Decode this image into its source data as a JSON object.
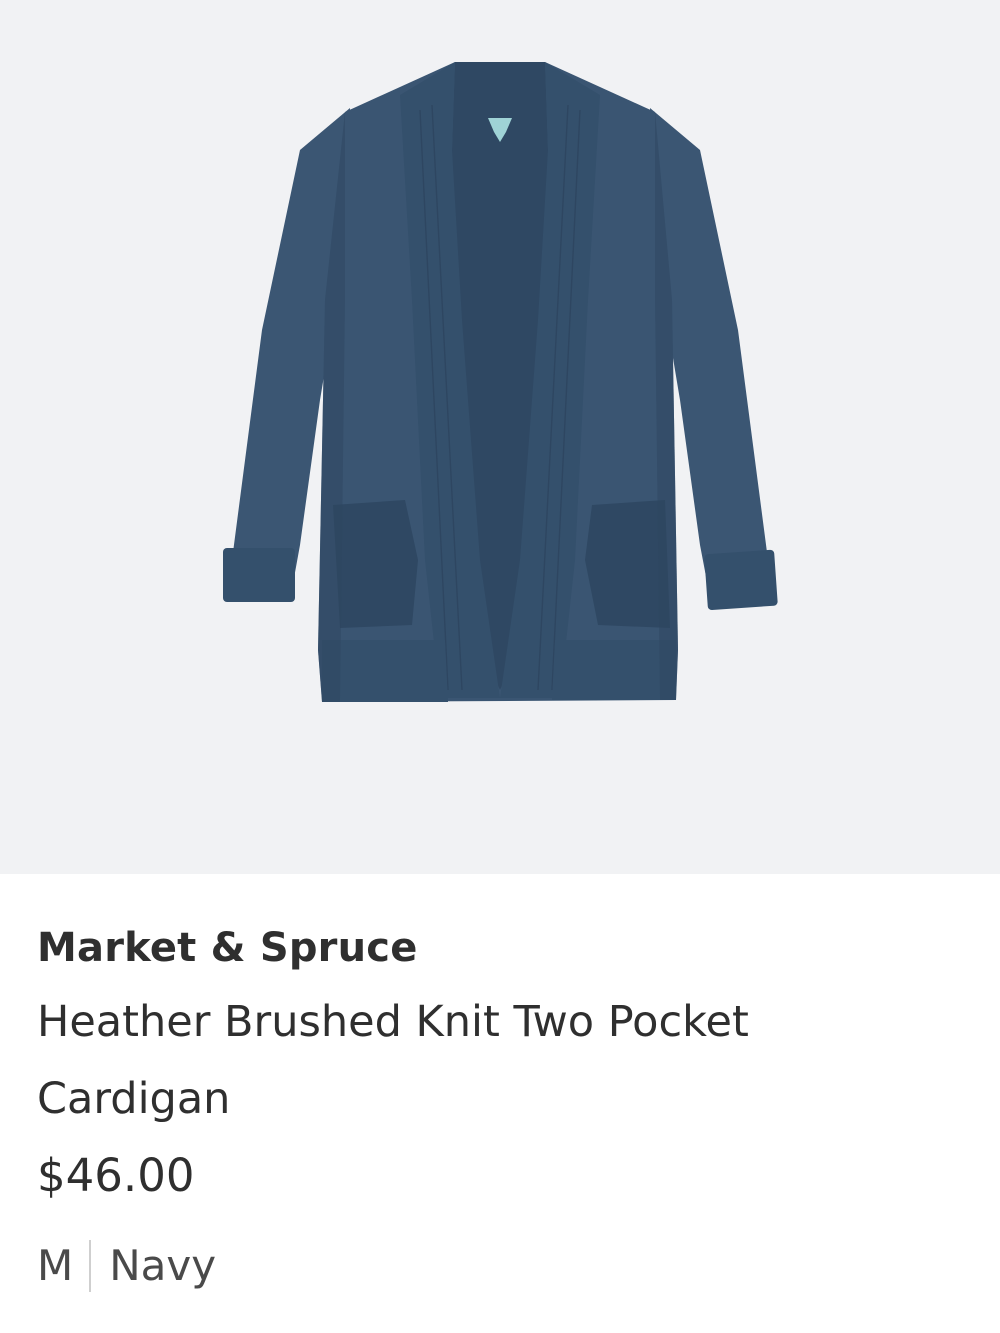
{
  "product": {
    "image_alt": "Navy heather brushed knit open-front cardigan with two pockets",
    "brand": "Market & Spruce",
    "name": "Heather Brushed Knit Two Pocket Cardigan",
    "price": "$46.00",
    "size": "M",
    "color": "Navy"
  },
  "colors": {
    "image_background": "#f1f2f4",
    "garment": "#3b5673",
    "garment_dark": "#2e4560",
    "garment_shadow": "#24384f",
    "tag": "#9fd3d6",
    "text": "#2f2f2f",
    "divider": "#cfcfcf"
  },
  "icons": {
    "product_image": "cardigan-illustration"
  }
}
